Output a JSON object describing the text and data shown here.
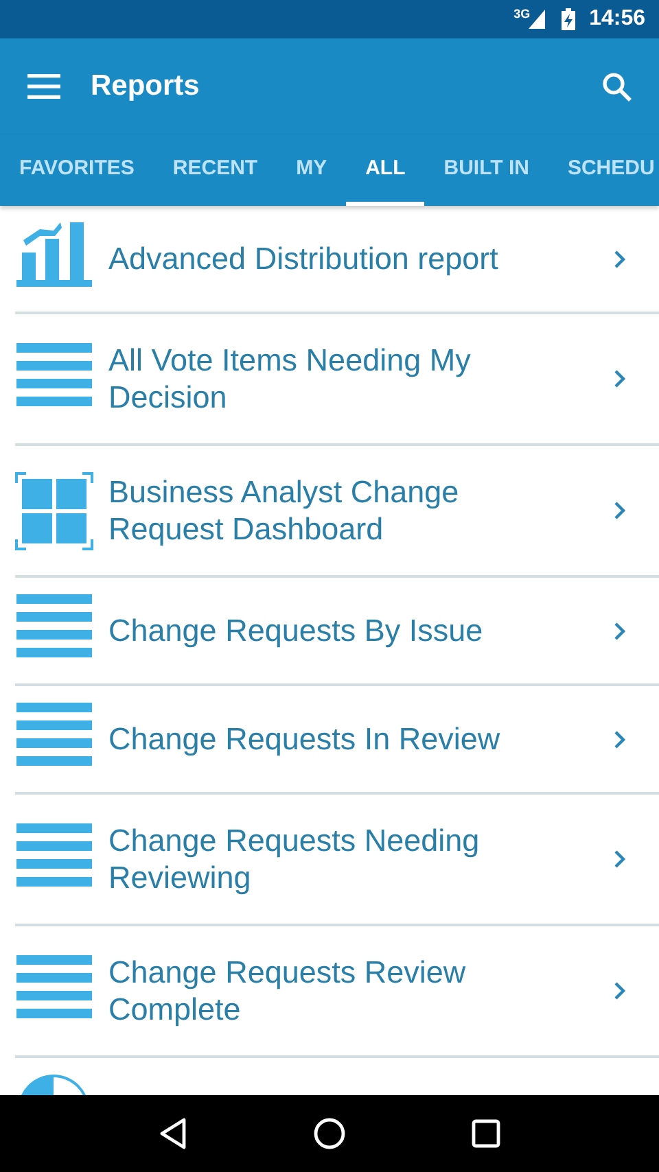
{
  "status_bar": {
    "network": "3G",
    "time": "14:56"
  },
  "app_bar": {
    "title": "Reports"
  },
  "tabs": [
    {
      "label": "FAVORITES",
      "selected": false
    },
    {
      "label": "RECENT",
      "selected": false
    },
    {
      "label": "MY",
      "selected": false
    },
    {
      "label": "ALL",
      "selected": true
    },
    {
      "label": "BUILT IN",
      "selected": false
    },
    {
      "label": "SCHEDU",
      "selected": false
    }
  ],
  "reports": [
    {
      "kind": "chart",
      "title": "Advanced Distribution report"
    },
    {
      "kind": "list",
      "title": "All Vote Items Needing My Decision"
    },
    {
      "kind": "dashboard",
      "title": "Business Analyst Change Request Dashboard"
    },
    {
      "kind": "list",
      "title": "Change Requests By Issue"
    },
    {
      "kind": "list",
      "title": "Change Requests In Review"
    },
    {
      "kind": "list",
      "title": "Change Requests Needing Reviewing"
    },
    {
      "kind": "list",
      "title": "Change Requests Review Complete"
    },
    {
      "kind": "distribution"
    }
  ]
}
